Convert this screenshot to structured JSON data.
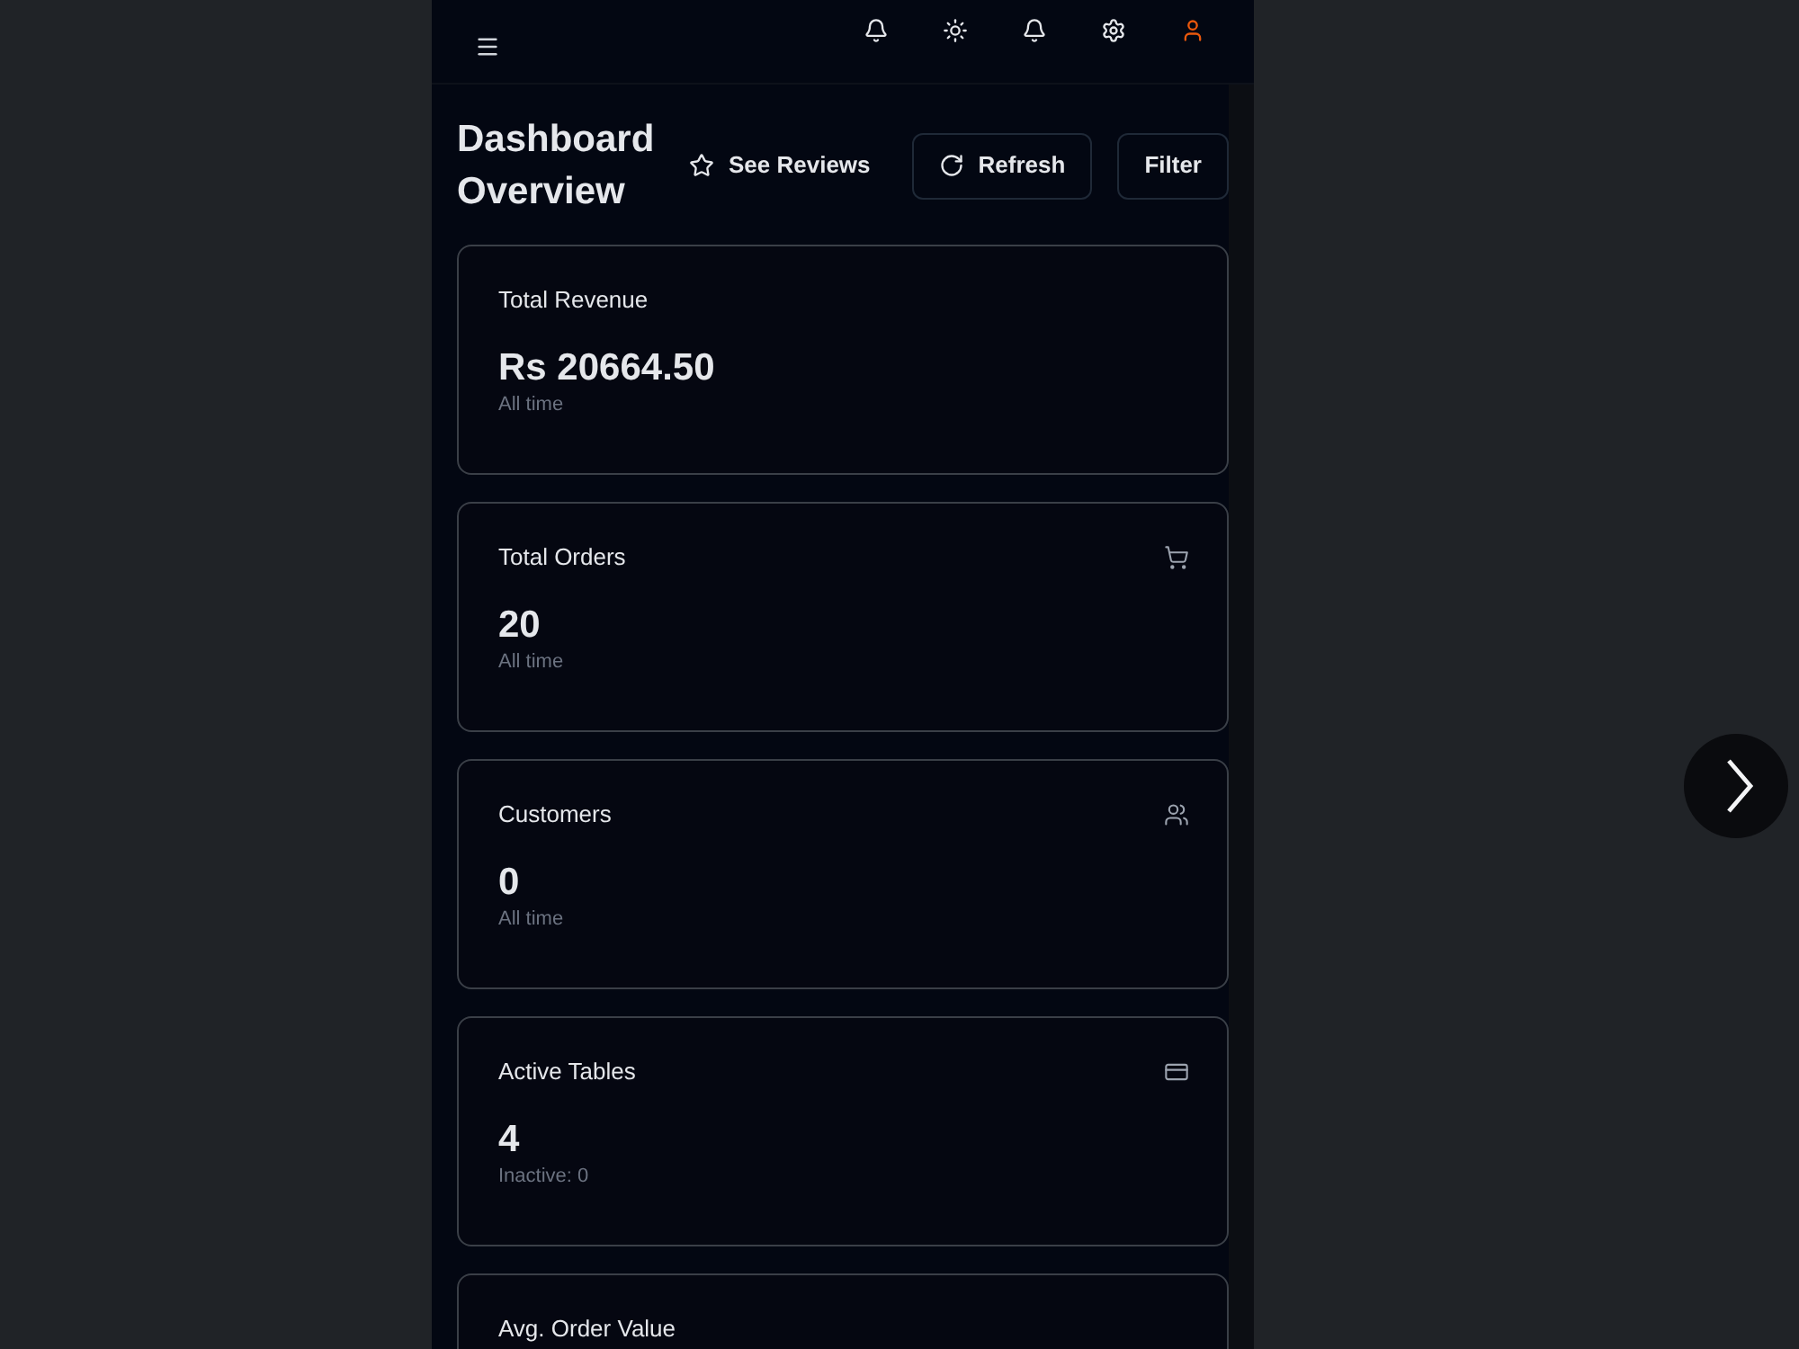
{
  "header": {
    "title": "Dashboard Overview",
    "buttons": [
      {
        "label": "See Reviews",
        "kind": "ghost"
      },
      {
        "label": "Refresh",
        "kind": "outline"
      },
      {
        "label": "Filter",
        "kind": "outline"
      }
    ]
  },
  "cards": [
    {
      "title": "Total Revenue",
      "value": "Rs 20664.50",
      "note": "All time"
    },
    {
      "title": "Total Orders",
      "value": "20",
      "note": "All time"
    },
    {
      "title": "Customers",
      "value": "0",
      "note": "All time"
    },
    {
      "title": "Active Tables",
      "value": "4",
      "note": "Inactive: 0"
    },
    {
      "title": "Avg. Order Value"
    }
  ]
}
